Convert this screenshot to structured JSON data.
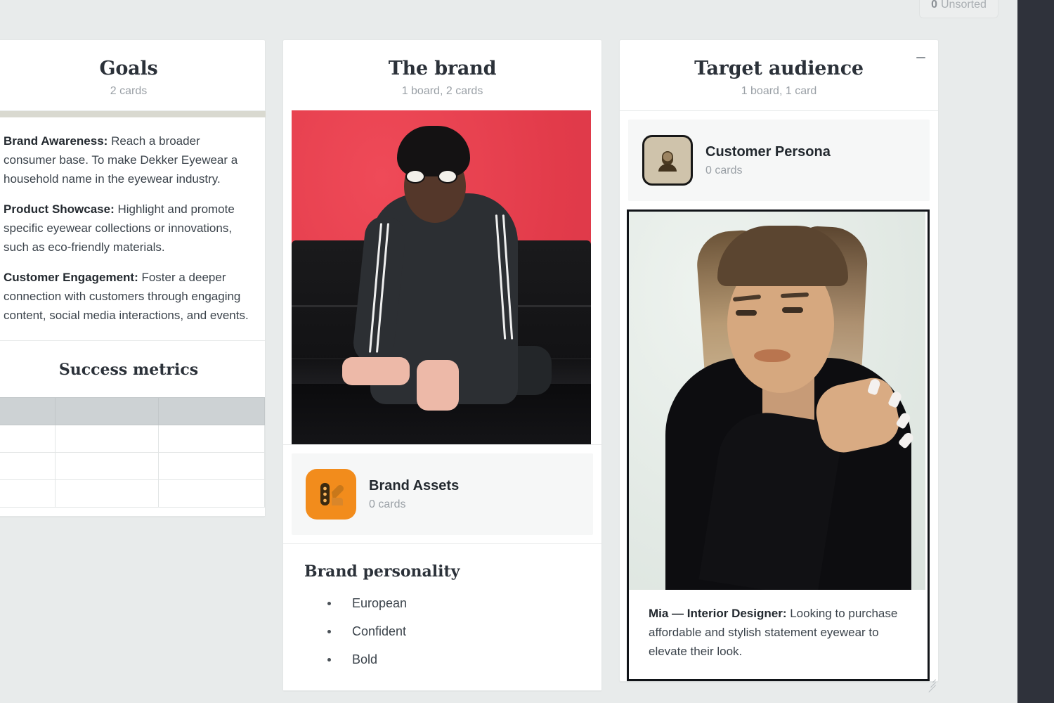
{
  "topbar": {
    "unsorted_count": "0",
    "unsorted_label": "Unsorted"
  },
  "columns": [
    {
      "id": "goals",
      "title": "Goals",
      "subtitle": "2 cards",
      "minimizable": false,
      "cards": [
        {
          "type": "note",
          "accent_color": "#d9d9d0",
          "paragraphs": [
            {
              "lead": "Brand Awareness:",
              "text": " Reach a broader consumer base. To make Dekker Eyewear a household name in the eyewear industry."
            },
            {
              "lead": "Product Showcase:",
              "text": " Highlight and promote specific eyewear collections or innovations, such as eco-friendly materials."
            },
            {
              "lead": "Customer Engagement:",
              "text": " Foster a deeper connection with customers through engaging content, social media interactions, and events."
            }
          ]
        },
        {
          "type": "table",
          "title": "Success metrics",
          "header_cells": [
            "",
            "",
            ""
          ],
          "rows": [
            [
              "",
              "",
              ""
            ],
            [
              "",
              "",
              ""
            ],
            [
              "",
              "",
              ""
            ]
          ]
        }
      ]
    },
    {
      "id": "brand",
      "title": "The brand",
      "subtitle": "1 board, 2 cards",
      "minimizable": false,
      "cards": [
        {
          "type": "photo",
          "alt": "Woman in dark tracksuit with sunglasses on a black leather couch against a red wall"
        },
        {
          "type": "board-tile",
          "icon": "color-palette-icon",
          "icon_bg": "#f28c1c",
          "name": "Brand Assets",
          "sub": "0 cards"
        },
        {
          "type": "bullets",
          "title": "Brand personality",
          "items": [
            "European",
            "Confident",
            "Bold"
          ]
        }
      ]
    },
    {
      "id": "audience",
      "title": "Target audience",
      "subtitle": "1 board, 1 card",
      "minimizable": true,
      "minimize_icon": "minimize-icon",
      "cards": [
        {
          "type": "board-tile",
          "icon": "person-avatar-icon",
          "icon_bg": "#cfc3ab",
          "name": "Customer Persona",
          "sub": "0 cards"
        },
        {
          "type": "persona",
          "selected": true,
          "alt": "Portrait of a person with long highlighted hair in a black turtleneck on a pale green background",
          "lead": "Mia — Interior Designer:",
          "text": " Looking to purchase affordable and stylish statement eyewear to elevate their look."
        }
      ]
    }
  ]
}
